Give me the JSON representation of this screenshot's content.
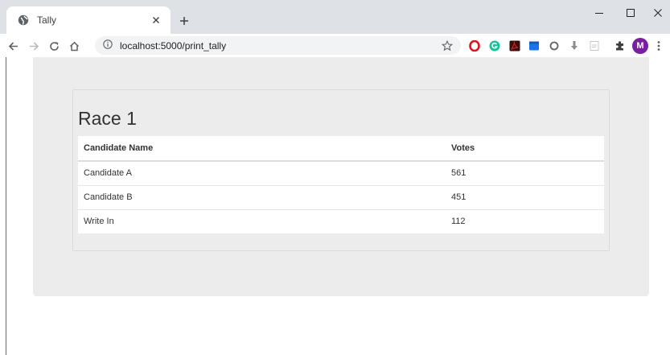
{
  "browser": {
    "tab": {
      "title": "Tally",
      "favicon": "globe-icon"
    },
    "url": "localhost:5000/print_tally",
    "profile_initial": "M",
    "colors": {
      "tabstrip": "#dee1e6",
      "profile": "#7b1fa2",
      "opera": "#e0141e",
      "grammarly": "#15c39a",
      "pdf": "#e02020",
      "blue_ext": "#1a73e8"
    },
    "extensions": [
      "opera-icon",
      "grammarly-icon",
      "pdf-icon",
      "blue-square-icon",
      "circle-ext-icon",
      "download-ext-icon",
      "note-ext-icon",
      "puzzle-icon"
    ]
  },
  "page": {
    "race_title": "Race 1",
    "table": {
      "headers": {
        "name": "Candidate Name",
        "votes": "Votes"
      },
      "rows": [
        {
          "name": "Candidate A",
          "votes": "561"
        },
        {
          "name": "Candidate B",
          "votes": "451"
        },
        {
          "name": "Write In",
          "votes": "112"
        }
      ]
    }
  }
}
